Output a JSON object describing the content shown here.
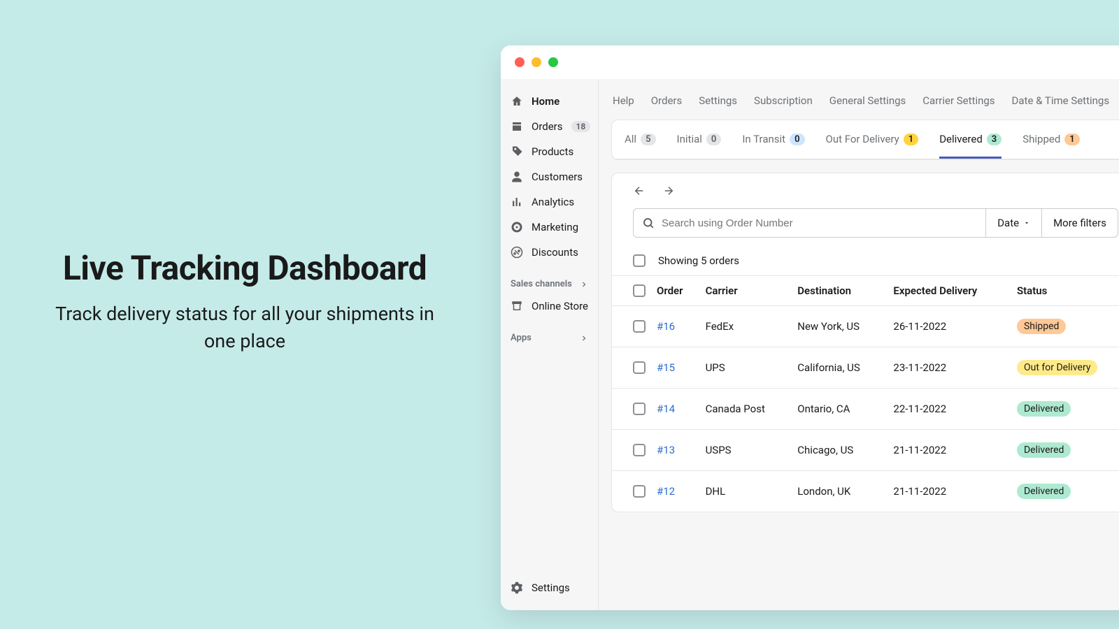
{
  "hero": {
    "title": "Live Tracking Dashboard",
    "subtitle": "Track delivery status for all your shipments in one place"
  },
  "sidebar": {
    "items": [
      {
        "icon": "home",
        "label": "Home"
      },
      {
        "icon": "orders",
        "label": "Orders",
        "badge": "18"
      },
      {
        "icon": "tag",
        "label": "Products"
      },
      {
        "icon": "person",
        "label": "Customers"
      },
      {
        "icon": "analytics",
        "label": "Analytics"
      },
      {
        "icon": "marketing",
        "label": "Marketing"
      },
      {
        "icon": "discounts",
        "label": "Discounts"
      }
    ],
    "sales_channels_label": "Sales channels",
    "online_store_label": "Online Store",
    "apps_label": "Apps",
    "settings_label": "Settings"
  },
  "breadcrumb": [
    "Help",
    "Orders",
    "Settings",
    "Subscription",
    "General Settings",
    "Carrier Settings",
    "Date & Time Settings"
  ],
  "tabs": [
    {
      "label": "All",
      "count": "5",
      "color": "gray"
    },
    {
      "label": "Initial",
      "count": "0",
      "color": "gray"
    },
    {
      "label": "In Transit",
      "count": "0",
      "color": "blue"
    },
    {
      "label": "Out For Delivery",
      "count": "1",
      "color": "yellow"
    },
    {
      "label": "Delivered",
      "count": "3",
      "color": "green",
      "active": true
    },
    {
      "label": "Shipped",
      "count": "1",
      "color": "orange"
    }
  ],
  "search_placeholder": "Search using Order Number",
  "date_btn": "Date",
  "more_filters_btn": "More filters",
  "showing_text": "Showing 5 orders",
  "columns": [
    "Order",
    "Carrier",
    "Destination",
    "Expected Delivery",
    "Status"
  ],
  "rows": [
    {
      "order": "#16",
      "carrier": "FedEx",
      "destination": "New York, US",
      "expected": "26-11-2022",
      "status": "Shipped",
      "pill": "shipped"
    },
    {
      "order": "#15",
      "carrier": "UPS",
      "destination": "California, US",
      "expected": "23-11-2022",
      "status": "Out for Delivery",
      "pill": "outfordelivery"
    },
    {
      "order": "#14",
      "carrier": "Canada Post",
      "destination": "Ontario, CA",
      "expected": "22-11-2022",
      "status": "Delivered",
      "pill": "delivered"
    },
    {
      "order": "#13",
      "carrier": "USPS",
      "destination": "Chicago, US",
      "expected": "21-11-2022",
      "status": "Delivered",
      "pill": "delivered"
    },
    {
      "order": "#12",
      "carrier": "DHL",
      "destination": "London, UK",
      "expected": "21-11-2022",
      "status": "Delivered",
      "pill": "delivered"
    }
  ]
}
